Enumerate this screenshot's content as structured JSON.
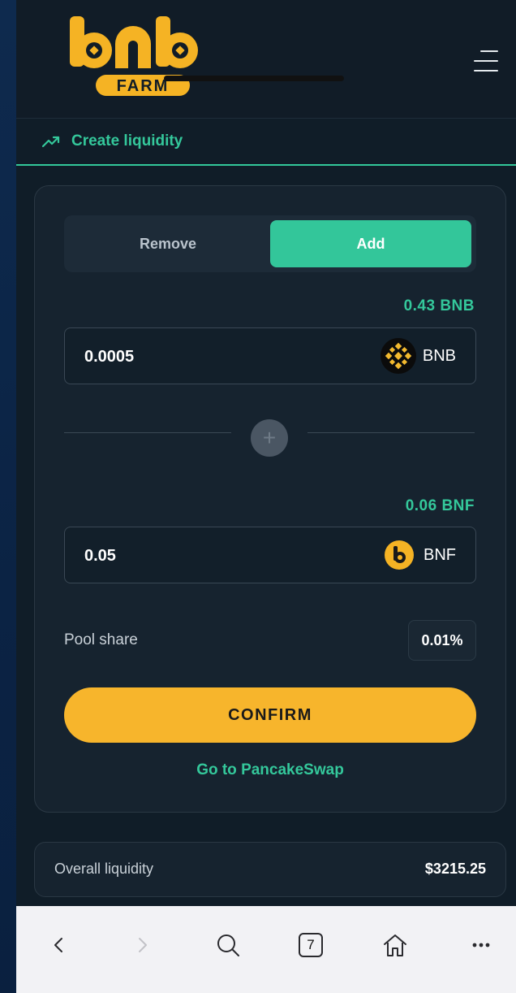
{
  "brand": {
    "logo_letters": "bnb",
    "logo_sub": "FARM"
  },
  "subnav": {
    "title": "Create liquidity",
    "icon": "trending-up-icon"
  },
  "toggle": {
    "remove_label": "Remove",
    "add_label": "Add",
    "active": "Add"
  },
  "token_a": {
    "balance": "0.43 BNB",
    "amount": "0.0005",
    "symbol": "BNB",
    "icon": "bnb-coin-icon"
  },
  "token_b": {
    "balance": "0.06 BNF",
    "amount": "0.05",
    "symbol": "BNF",
    "icon": "bnf-coin-icon"
  },
  "pool": {
    "label": "Pool share",
    "value": "0.01%"
  },
  "actions": {
    "confirm_label": "CONFIRM",
    "pancake_link": "Go to PancakeSwap"
  },
  "overall": {
    "label": "Overall liquidity",
    "value": "$3215.25"
  },
  "browser": {
    "tab_count": "7"
  },
  "colors": {
    "accent": "#33c69a",
    "confirm": "#f7b52c",
    "background": "#101d28",
    "brand_yellow": "#f5b324"
  }
}
